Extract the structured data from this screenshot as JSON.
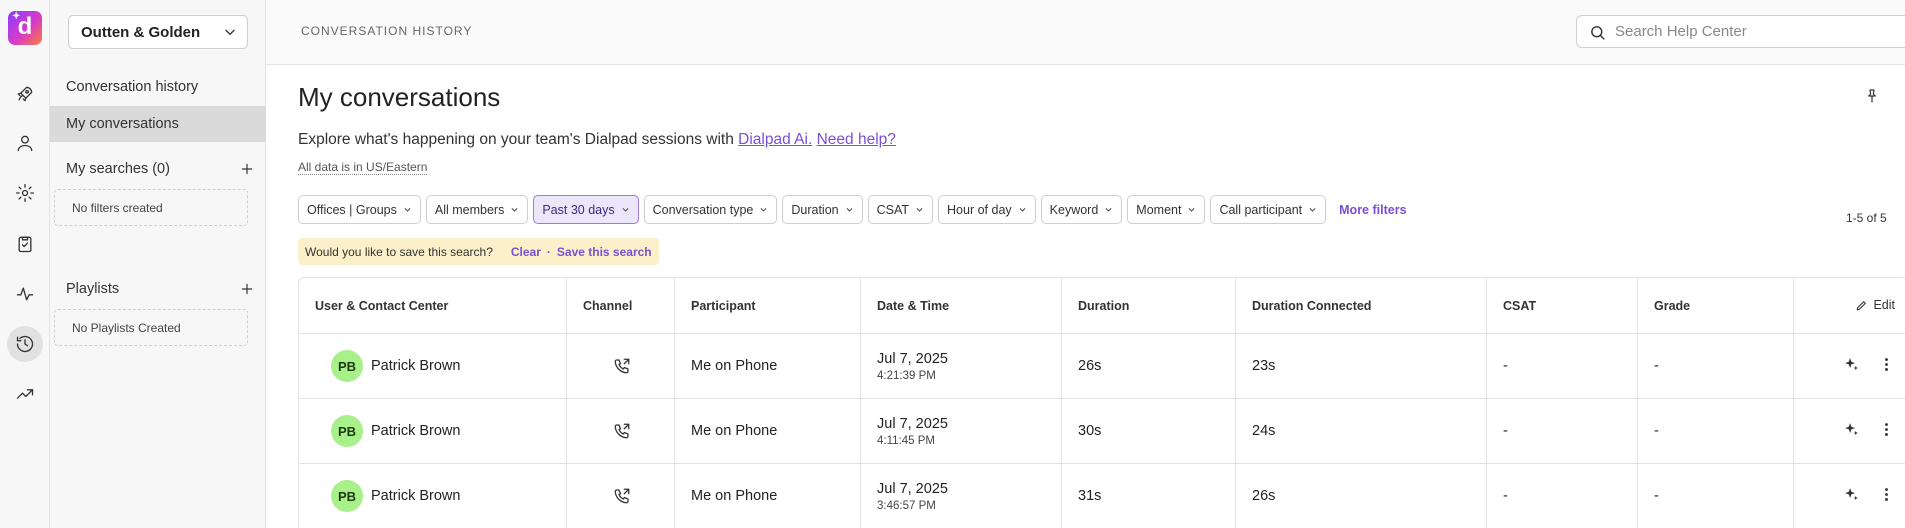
{
  "app": {
    "logo_letter": "d",
    "brand_colors": [
      "#8a3cff",
      "#d63cc6",
      "#ff7a3c"
    ],
    "accent_color": "#7a4fd6"
  },
  "rail": {
    "items": [
      {
        "icon": "rocket-icon"
      },
      {
        "icon": "person-icon"
      },
      {
        "icon": "gear-icon"
      },
      {
        "icon": "clipboard-icon"
      },
      {
        "icon": "activity-icon"
      },
      {
        "icon": "history-icon",
        "active": true
      },
      {
        "icon": "trending-up-icon"
      }
    ]
  },
  "sidebar": {
    "org_select": "Outten & Golden",
    "links": [
      {
        "label": "Conversation history",
        "active": false
      },
      {
        "label": "My conversations",
        "active": true
      }
    ],
    "my_searches_label": "My searches (0)",
    "no_filters": "No filters created",
    "playlists_label": "Playlists",
    "no_playlists": "No Playlists Created"
  },
  "header": {
    "breadcrumb": "CONVERSATION HISTORY",
    "search_placeholder": "Search Help Center"
  },
  "main": {
    "title": "My conversations",
    "subtitle_text": "Explore what's happening on your team's Dialpad sessions with",
    "subtitle_link1": "Dialpad Ai.",
    "subtitle_link2": "Need help?",
    "timezone_note": "All data is in US/Eastern",
    "filters": [
      {
        "label": "Offices | Groups",
        "active": false
      },
      {
        "label": "All members",
        "active": false
      },
      {
        "label": "Past 30 days",
        "active": true
      },
      {
        "label": "Conversation type",
        "active": false
      },
      {
        "label": "Duration",
        "active": false
      },
      {
        "label": "CSAT",
        "active": false
      },
      {
        "label": "Hour of day",
        "active": false
      },
      {
        "label": "Keyword",
        "active": false
      },
      {
        "label": "Moment",
        "active": false
      },
      {
        "label": "Call participant",
        "active": false
      }
    ],
    "more_filters": "More filters",
    "result_count": "1-5 of 5",
    "save_prompt": "Would you like to save this search?",
    "save_clear": "Clear",
    "save_separator": "·",
    "save_action": "Save this search"
  },
  "table": {
    "columns": [
      "User & Contact Center",
      "Channel",
      "Participant",
      "Date & Time",
      "Duration",
      "Duration Connected",
      "CSAT",
      "Grade"
    ],
    "edit_label": "Edit",
    "rows": [
      {
        "initials": "PB",
        "user": "Patrick Brown",
        "channel_icon": "phone-call-icon",
        "participant": "Me on Phone",
        "date": "Jul 7, 2025",
        "time": "4:21:39 PM",
        "duration": "26s",
        "connected": "23s",
        "csat": "-",
        "grade": "-"
      },
      {
        "initials": "PB",
        "user": "Patrick Brown",
        "channel_icon": "phone-call-icon",
        "participant": "Me on Phone",
        "date": "Jul 7, 2025",
        "time": "4:11:45 PM",
        "duration": "30s",
        "connected": "24s",
        "csat": "-",
        "grade": "-"
      },
      {
        "initials": "PB",
        "user": "Patrick Brown",
        "channel_icon": "phone-call-icon",
        "participant": "Me on Phone",
        "date": "Jul 7, 2025",
        "time": "3:46:57 PM",
        "duration": "31s",
        "connected": "26s",
        "csat": "-",
        "grade": "-"
      }
    ]
  }
}
